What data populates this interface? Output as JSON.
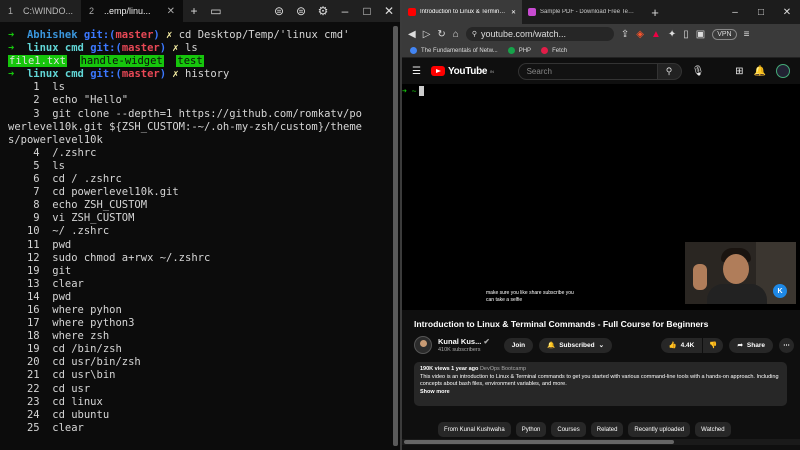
{
  "terminal": {
    "tabs": [
      {
        "num": "1",
        "label": "C:\\WINDO..."
      },
      {
        "num": "2",
        "label": "..emp/linu..."
      }
    ],
    "lines": [
      {
        "type": "prompt",
        "user": "Abhishek",
        "git": "git:(",
        "branch": "master",
        "git_close": ")",
        "x": "✗",
        "cmd": " cd Desktop/Temp/'linux cmd'"
      },
      {
        "type": "prompt2",
        "dir": "linux cmd",
        "git": "git:(",
        "branch": "master",
        "git_close": ")",
        "x": "✗",
        "cmd": " ls"
      },
      {
        "type": "ls",
        "items": [
          "file1.txt",
          "handle-widget",
          "test"
        ]
      },
      {
        "type": "prompt2",
        "dir": "linux cmd",
        "git": "git:(",
        "branch": "master",
        "git_close": ")",
        "x": "✗",
        "cmd": " history"
      }
    ],
    "history": [
      "    1  ls",
      "    2  echo \"Hello\"",
      "    3  git clone --depth=1 https://github.com/romkatv/po",
      "werlevel10k.git ${ZSH_CUSTOM:-~/.oh-my-zsh/custom}/theme",
      "s/powerlevel10k",
      "    4  /.zshrc",
      "    5  ls",
      "    6  cd / .zshrc",
      "    7  cd powerlevel10k.git",
      "    8  echo ZSH_CUSTOM",
      "    9  vi ZSH_CUSTOM",
      "   10  ~/ .zshrc",
      "   11  pwd",
      "   12  sudo chmod a+rwx ~/.zshrc",
      "   19  git",
      "   13  clear",
      "   14  pwd",
      "   16  where pyhon",
      "   17  where python3",
      "   18  where zsh",
      "   19  cd /bin/zsh",
      "   20  cd usr/bin/zsh",
      "   21  cd usr\\bin",
      "   22  cd usr",
      "   23  cd linux",
      "   24  cd ubuntu",
      "   25  clear"
    ]
  },
  "browser": {
    "tabs": [
      {
        "label": "Introduction to Linux & Terminal C",
        "color": "#ff0000"
      },
      {
        "label": "Sample PDF - Download Free Test PDF | Sm",
        "color": "#c84bd1"
      }
    ],
    "url": "youtube.com/watch...",
    "vpn_label": "VPN",
    "bookmarks": [
      {
        "label": "The Fundamentals of Netw...",
        "color": "#4285f4"
      },
      {
        "label": "PHP",
        "color": "#16a34a"
      },
      {
        "label": "Fetch",
        "color": "#e11d48"
      }
    ],
    "youtube": {
      "logo_text": "YouTube",
      "logo_sup": "IN",
      "search_placeholder": "Search",
      "video_prompt": "➜ ~",
      "caption_line1": "make sure you like share subscribe you",
      "caption_line2": "can take a selfie",
      "webcam_badge": "K",
      "title": "Introduction to Linux & Terminal Commands - Full Course for Beginners",
      "channel_name": "Kunal Kus...",
      "channel_subs": "410K subscribers",
      "join_label": "Join",
      "subscribed_label": "Subscribed",
      "likes": "4.4K",
      "share_label": "Share",
      "desc_views": "190K views  1 year ago",
      "desc_tag": "DevOps Bootcamp",
      "desc_text": "This video is an introduction to Linux & Terminal commands to get you started with various command-line tools with a hands-on approach. Including concepts about bash files, environment variables, and more.",
      "show_more": "Show more",
      "chips": [
        "From Kunal Kushwaha",
        "Python",
        "Courses",
        "Related",
        "Recently uploaded",
        "Watched"
      ]
    }
  }
}
